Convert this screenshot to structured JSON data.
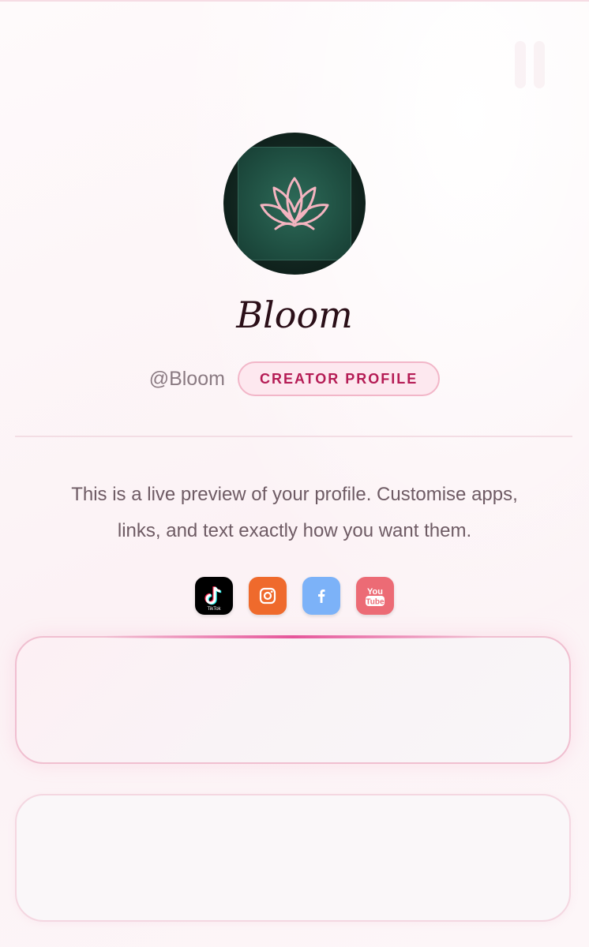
{
  "profile": {
    "name": "Bloom",
    "handle": "@Bloom",
    "badge": "CREATOR PROFILE",
    "bio": "This is a live preview of your profile. Customise apps, links, and text exactly how you want them."
  },
  "socials": [
    {
      "name": "TikTok",
      "icon": "tiktok-icon",
      "color": "#000000",
      "label": "TikTok"
    },
    {
      "name": "Instagram",
      "icon": "instagram-icon",
      "color": "#ef6a2c"
    },
    {
      "name": "Facebook",
      "icon": "facebook-icon",
      "color": "#7cb2f8"
    },
    {
      "name": "YouTube",
      "icon": "youtube-icon",
      "color": "#ec6b75",
      "label_top": "You",
      "label_bottom": "Tube"
    }
  ],
  "colors": {
    "accent": "#b51c55",
    "badge_border": "#f2b6c8",
    "badge_bg": "#fde8ef",
    "card_border": "#f0bfd0",
    "avatar_green": "#1e4d40",
    "lotus_pink": "#f4b4c0"
  }
}
